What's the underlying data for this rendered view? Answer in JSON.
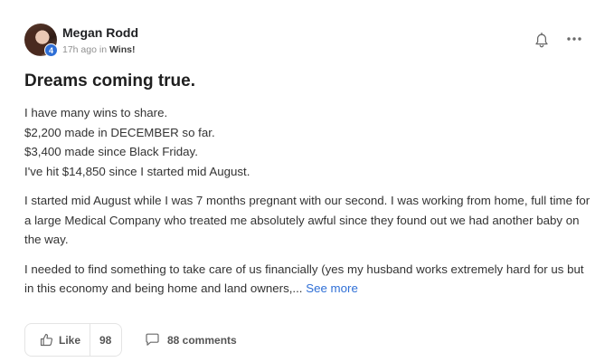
{
  "post": {
    "author": "Megan Rodd",
    "level": "4",
    "time": "17h ago in",
    "category": "Wins!",
    "title": "Dreams coming true.",
    "lines": [
      "I have many wins to share.",
      "$2,200 made in DECEMBER so far.",
      "$3,400 made since Black Friday.",
      "I've hit $14,850 since I started mid August."
    ],
    "para2": "I started mid August while I was 7 months pregnant with our second. I was working from home, full time for a large Medical Company who treated me absolutely awful since they found out we had another baby on the way.",
    "para3": "I needed to find something to take care of us financially (yes my husband works extremely hard for us but in this economy and being home and land owners,...",
    "see_more": "See more"
  },
  "footer": {
    "like_label": "Like",
    "like_count": "98",
    "comments_label": "88 comments"
  },
  "icons": {
    "bell": "bell-icon",
    "more": "more-icon",
    "like": "thumbs-up-icon",
    "comment": "comment-icon"
  },
  "colors": {
    "accent": "#2f6fd6",
    "text": "#333333",
    "muted": "#909090"
  }
}
